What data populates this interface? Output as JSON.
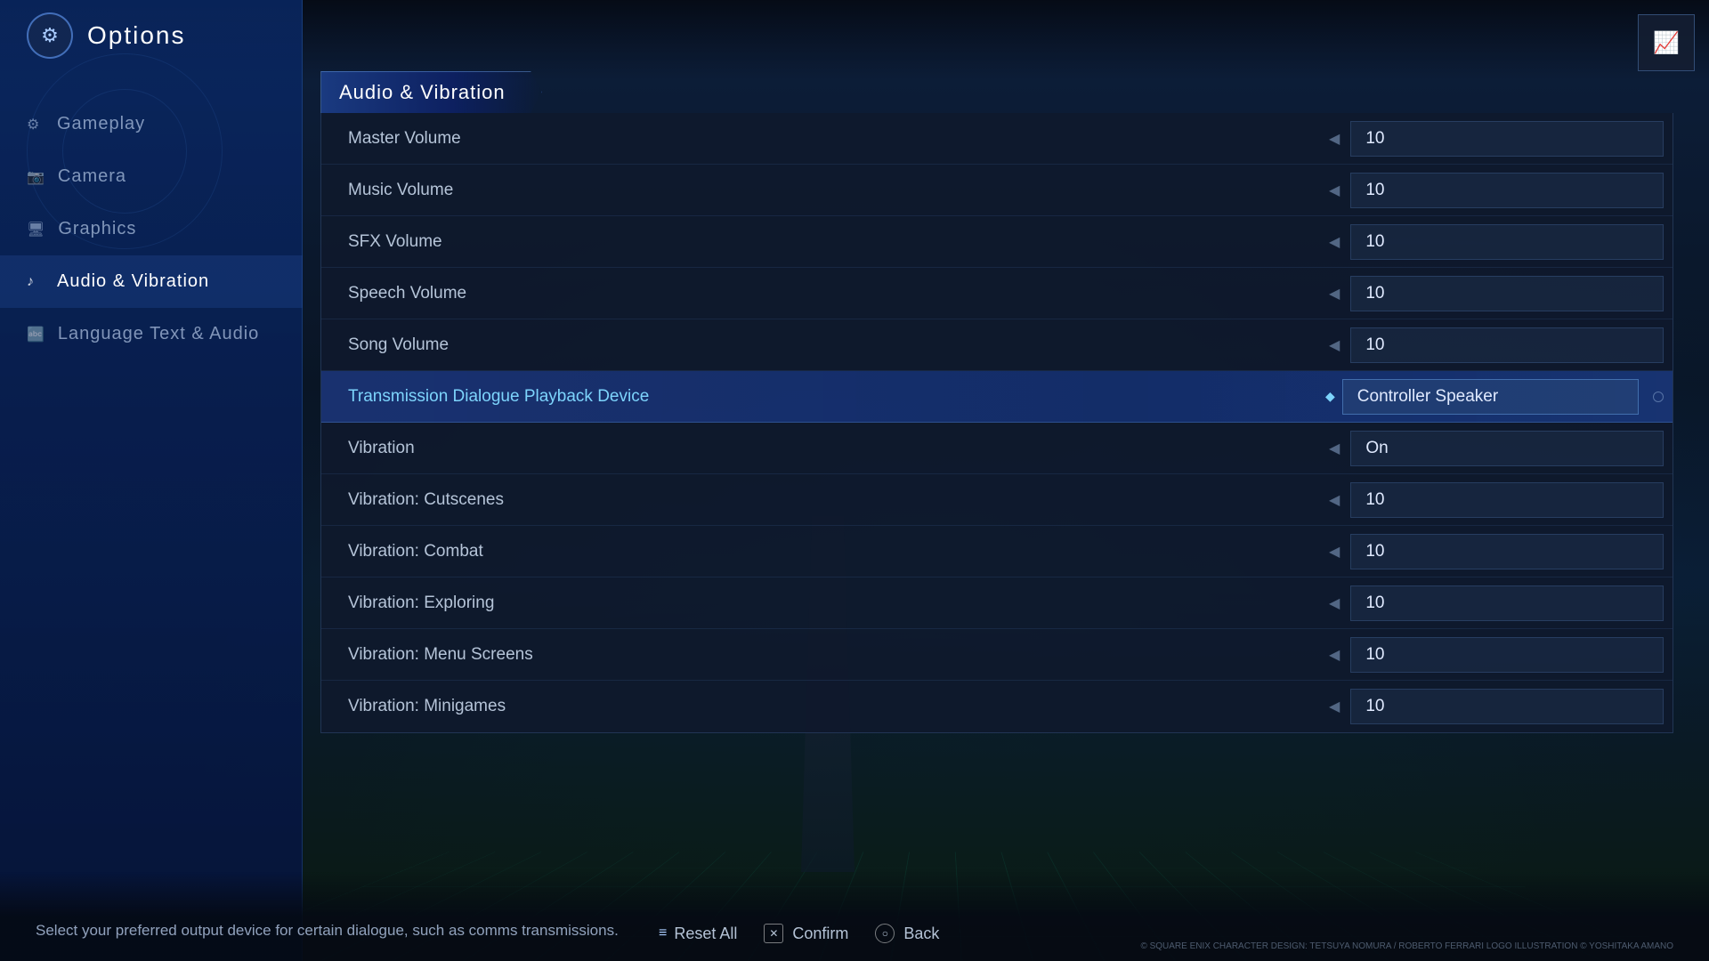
{
  "app": {
    "title": "Options",
    "icon": "⚙"
  },
  "topRight": {
    "icon": "📊"
  },
  "sidebar": {
    "items": [
      {
        "id": "gameplay",
        "label": "Gameplay",
        "icon": "⚙"
      },
      {
        "id": "camera",
        "label": "Camera",
        "icon": "📷"
      },
      {
        "id": "graphics",
        "label": "Graphics",
        "icon": "🖥"
      },
      {
        "id": "audio-vibration",
        "label": "Audio & Vibration",
        "icon": "🎵",
        "active": true
      },
      {
        "id": "language",
        "label": "Language Text & Audio",
        "icon": "🔤"
      }
    ]
  },
  "section": {
    "title": "Audio & Vibration"
  },
  "settings": {
    "rows": [
      {
        "id": "master-volume",
        "label": "Master Volume",
        "value": "10",
        "type": "number",
        "highlighted": false
      },
      {
        "id": "music-volume",
        "label": "Music Volume",
        "value": "10",
        "type": "number",
        "highlighted": false
      },
      {
        "id": "sfx-volume",
        "label": "SFX Volume",
        "value": "10",
        "type": "number",
        "highlighted": false
      },
      {
        "id": "speech-volume",
        "label": "Speech Volume",
        "value": "10",
        "type": "number",
        "highlighted": false
      },
      {
        "id": "song-volume",
        "label": "Song Volume",
        "value": "10",
        "type": "number",
        "highlighted": false
      },
      {
        "id": "transmission-dialogue",
        "label": "Transmission Dialogue Playback Device",
        "value": "Controller Speaker",
        "type": "select",
        "highlighted": true
      },
      {
        "id": "vibration",
        "label": "Vibration",
        "value": "On",
        "type": "toggle",
        "highlighted": false
      },
      {
        "id": "vibration-cutscenes",
        "label": "Vibration: Cutscenes",
        "value": "10",
        "type": "number",
        "highlighted": false
      },
      {
        "id": "vibration-combat",
        "label": "Vibration: Combat",
        "value": "10",
        "type": "number",
        "highlighted": false
      },
      {
        "id": "vibration-exploring",
        "label": "Vibration: Exploring",
        "value": "10",
        "type": "number",
        "highlighted": false
      },
      {
        "id": "vibration-menu-screens",
        "label": "Vibration: Menu Screens",
        "value": "10",
        "type": "number",
        "highlighted": false
      },
      {
        "id": "vibration-minigames",
        "label": "Vibration: Minigames",
        "value": "10",
        "type": "number",
        "highlighted": false
      }
    ]
  },
  "bottomHint": "Select your preferred output device for certain dialogue, such as comms transmissions.",
  "bottomActions": {
    "resetAll": "Reset All",
    "confirm": "Confirm",
    "back": "Back"
  },
  "copyright": "© SQUARE ENIX\nCHARACTER DESIGN: TETSUYA NOMURA / ROBERTO FERRARI\nLOGO ILLUSTRATION © YOSHITAKA AMANO"
}
